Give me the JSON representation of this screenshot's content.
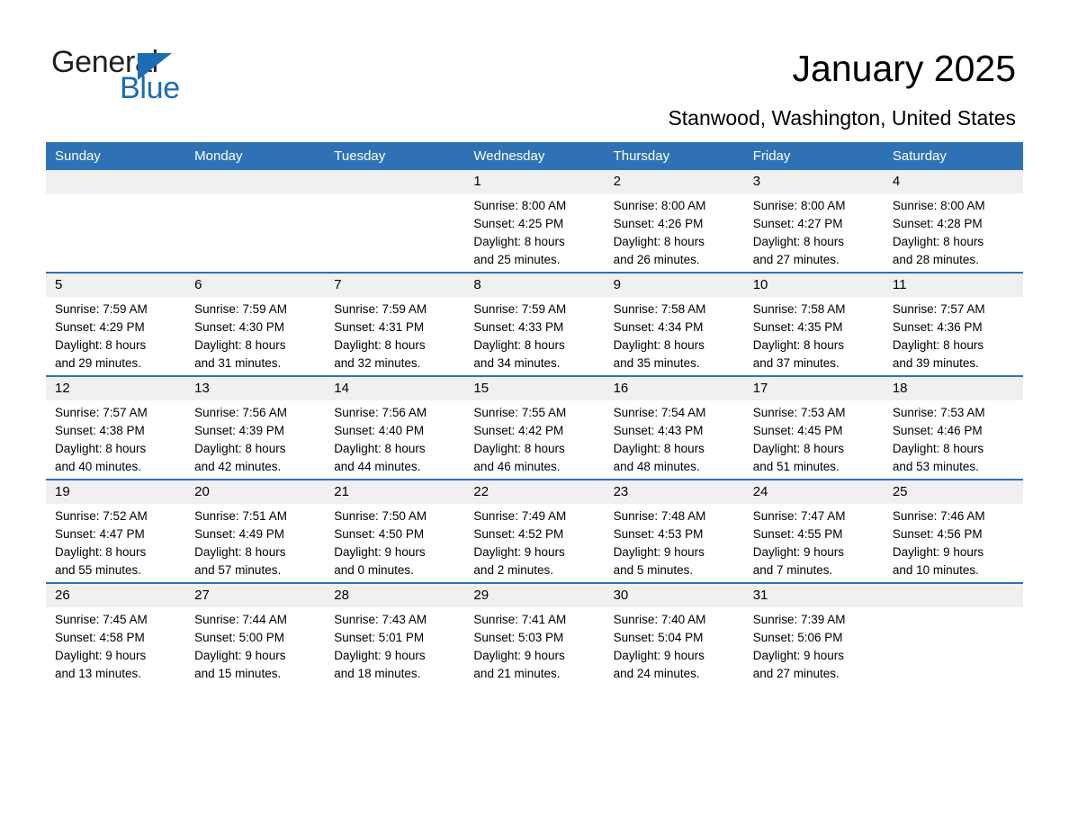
{
  "brand": {
    "word_one": "General",
    "word_two": "Blue",
    "triangle_icon": "triangle-icon",
    "accent_color": "#1b6cb5"
  },
  "header": {
    "title": "January 2025",
    "subtitle": "Stanwood, Washington, United States"
  },
  "theme": {
    "header_blue": "#2e72b5",
    "daynum_gray": "#f0f0f0",
    "text_black": "#000000"
  },
  "calendar": {
    "weekday_headers": [
      "Sunday",
      "Monday",
      "Tuesday",
      "Wednesday",
      "Thursday",
      "Friday",
      "Saturday"
    ],
    "weeks": [
      [
        {
          "day": "",
          "lines": []
        },
        {
          "day": "",
          "lines": []
        },
        {
          "day": "",
          "lines": []
        },
        {
          "day": "1",
          "lines": [
            "Sunrise: 8:00 AM",
            "Sunset: 4:25 PM",
            "Daylight: 8 hours",
            "and 25 minutes."
          ]
        },
        {
          "day": "2",
          "lines": [
            "Sunrise: 8:00 AM",
            "Sunset: 4:26 PM",
            "Daylight: 8 hours",
            "and 26 minutes."
          ]
        },
        {
          "day": "3",
          "lines": [
            "Sunrise: 8:00 AM",
            "Sunset: 4:27 PM",
            "Daylight: 8 hours",
            "and 27 minutes."
          ]
        },
        {
          "day": "4",
          "lines": [
            "Sunrise: 8:00 AM",
            "Sunset: 4:28 PM",
            "Daylight: 8 hours",
            "and 28 minutes."
          ]
        }
      ],
      [
        {
          "day": "5",
          "lines": [
            "Sunrise: 7:59 AM",
            "Sunset: 4:29 PM",
            "Daylight: 8 hours",
            "and 29 minutes."
          ]
        },
        {
          "day": "6",
          "lines": [
            "Sunrise: 7:59 AM",
            "Sunset: 4:30 PM",
            "Daylight: 8 hours",
            "and 31 minutes."
          ]
        },
        {
          "day": "7",
          "lines": [
            "Sunrise: 7:59 AM",
            "Sunset: 4:31 PM",
            "Daylight: 8 hours",
            "and 32 minutes."
          ]
        },
        {
          "day": "8",
          "lines": [
            "Sunrise: 7:59 AM",
            "Sunset: 4:33 PM",
            "Daylight: 8 hours",
            "and 34 minutes."
          ]
        },
        {
          "day": "9",
          "lines": [
            "Sunrise: 7:58 AM",
            "Sunset: 4:34 PM",
            "Daylight: 8 hours",
            "and 35 minutes."
          ]
        },
        {
          "day": "10",
          "lines": [
            "Sunrise: 7:58 AM",
            "Sunset: 4:35 PM",
            "Daylight: 8 hours",
            "and 37 minutes."
          ]
        },
        {
          "day": "11",
          "lines": [
            "Sunrise: 7:57 AM",
            "Sunset: 4:36 PM",
            "Daylight: 8 hours",
            "and 39 minutes."
          ]
        }
      ],
      [
        {
          "day": "12",
          "lines": [
            "Sunrise: 7:57 AM",
            "Sunset: 4:38 PM",
            "Daylight: 8 hours",
            "and 40 minutes."
          ]
        },
        {
          "day": "13",
          "lines": [
            "Sunrise: 7:56 AM",
            "Sunset: 4:39 PM",
            "Daylight: 8 hours",
            "and 42 minutes."
          ]
        },
        {
          "day": "14",
          "lines": [
            "Sunrise: 7:56 AM",
            "Sunset: 4:40 PM",
            "Daylight: 8 hours",
            "and 44 minutes."
          ]
        },
        {
          "day": "15",
          "lines": [
            "Sunrise: 7:55 AM",
            "Sunset: 4:42 PM",
            "Daylight: 8 hours",
            "and 46 minutes."
          ]
        },
        {
          "day": "16",
          "lines": [
            "Sunrise: 7:54 AM",
            "Sunset: 4:43 PM",
            "Daylight: 8 hours",
            "and 48 minutes."
          ]
        },
        {
          "day": "17",
          "lines": [
            "Sunrise: 7:53 AM",
            "Sunset: 4:45 PM",
            "Daylight: 8 hours",
            "and 51 minutes."
          ]
        },
        {
          "day": "18",
          "lines": [
            "Sunrise: 7:53 AM",
            "Sunset: 4:46 PM",
            "Daylight: 8 hours",
            "and 53 minutes."
          ]
        }
      ],
      [
        {
          "day": "19",
          "lines": [
            "Sunrise: 7:52 AM",
            "Sunset: 4:47 PM",
            "Daylight: 8 hours",
            "and 55 minutes."
          ]
        },
        {
          "day": "20",
          "lines": [
            "Sunrise: 7:51 AM",
            "Sunset: 4:49 PM",
            "Daylight: 8 hours",
            "and 57 minutes."
          ]
        },
        {
          "day": "21",
          "lines": [
            "Sunrise: 7:50 AM",
            "Sunset: 4:50 PM",
            "Daylight: 9 hours",
            "and 0 minutes."
          ]
        },
        {
          "day": "22",
          "lines": [
            "Sunrise: 7:49 AM",
            "Sunset: 4:52 PM",
            "Daylight: 9 hours",
            "and 2 minutes."
          ]
        },
        {
          "day": "23",
          "lines": [
            "Sunrise: 7:48 AM",
            "Sunset: 4:53 PM",
            "Daylight: 9 hours",
            "and 5 minutes."
          ]
        },
        {
          "day": "24",
          "lines": [
            "Sunrise: 7:47 AM",
            "Sunset: 4:55 PM",
            "Daylight: 9 hours",
            "and 7 minutes."
          ]
        },
        {
          "day": "25",
          "lines": [
            "Sunrise: 7:46 AM",
            "Sunset: 4:56 PM",
            "Daylight: 9 hours",
            "and 10 minutes."
          ]
        }
      ],
      [
        {
          "day": "26",
          "lines": [
            "Sunrise: 7:45 AM",
            "Sunset: 4:58 PM",
            "Daylight: 9 hours",
            "and 13 minutes."
          ]
        },
        {
          "day": "27",
          "lines": [
            "Sunrise: 7:44 AM",
            "Sunset: 5:00 PM",
            "Daylight: 9 hours",
            "and 15 minutes."
          ]
        },
        {
          "day": "28",
          "lines": [
            "Sunrise: 7:43 AM",
            "Sunset: 5:01 PM",
            "Daylight: 9 hours",
            "and 18 minutes."
          ]
        },
        {
          "day": "29",
          "lines": [
            "Sunrise: 7:41 AM",
            "Sunset: 5:03 PM",
            "Daylight: 9 hours",
            "and 21 minutes."
          ]
        },
        {
          "day": "30",
          "lines": [
            "Sunrise: 7:40 AM",
            "Sunset: 5:04 PM",
            "Daylight: 9 hours",
            "and 24 minutes."
          ]
        },
        {
          "day": "31",
          "lines": [
            "Sunrise: 7:39 AM",
            "Sunset: 5:06 PM",
            "Daylight: 9 hours",
            "and 27 minutes."
          ]
        },
        {
          "day": "",
          "lines": []
        }
      ]
    ]
  }
}
